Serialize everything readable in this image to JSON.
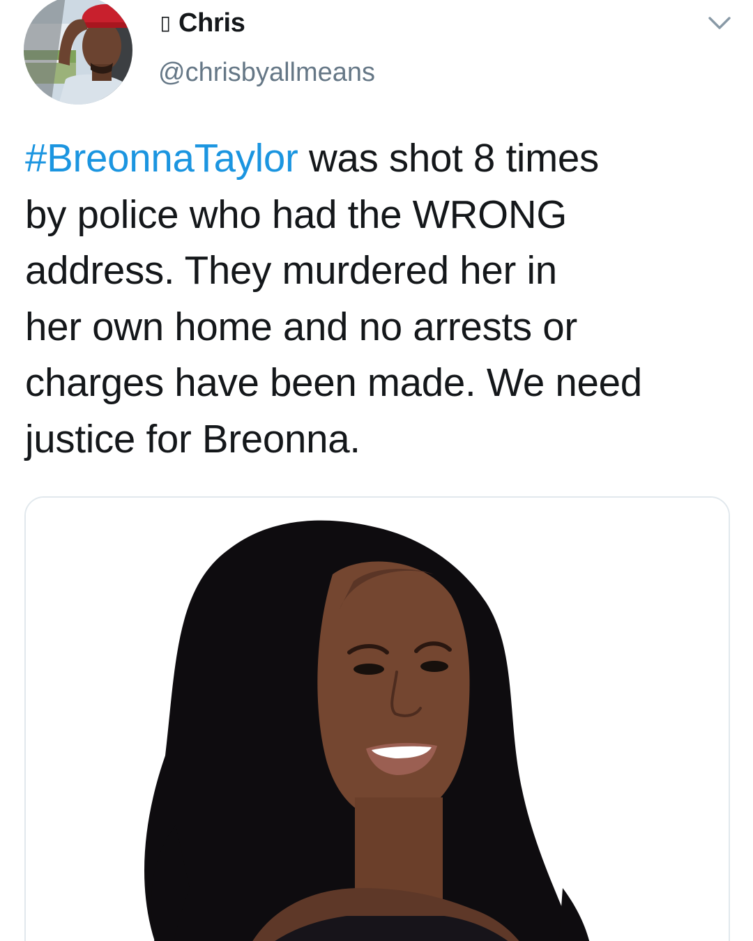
{
  "tweet": {
    "author": {
      "display_name": "Chris",
      "name_prefix_emoji": "▯",
      "handle": "@chrisbyallmeans"
    },
    "menu_icon": "chevron-down-icon",
    "text_lines": [
      {
        "hashtag": "#BreonnaTaylor",
        "text": " was shot 8 times"
      },
      {
        "text": "by police who had the WRONG"
      },
      {
        "text": "address. They murdered her in"
      },
      {
        "text": "her own home and no arrests or"
      },
      {
        "text": "charges have been made. We need"
      },
      {
        "text": "justice for Breonna."
      }
    ],
    "colors": {
      "text": "#14171a",
      "secondary_text": "#657786",
      "hashtag": "#1b95e0",
      "card_border": "#e1e8ed"
    }
  }
}
